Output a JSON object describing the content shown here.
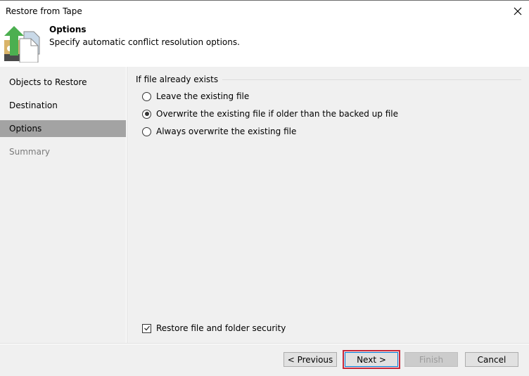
{
  "window": {
    "title": "Restore from Tape",
    "close_icon": "close-icon"
  },
  "header": {
    "icon": "restore-from-tape-icon",
    "heading": "Options",
    "subtitle": "Specify automatic conflict resolution options."
  },
  "sidebar": {
    "items": [
      {
        "label": "Objects to Restore",
        "state": "normal"
      },
      {
        "label": "Destination",
        "state": "normal"
      },
      {
        "label": "Options",
        "state": "active"
      },
      {
        "label": "Summary",
        "state": "disabled"
      }
    ]
  },
  "options": {
    "group_label": "If file already exists",
    "radios": [
      {
        "label": "Leave the existing file",
        "checked": false
      },
      {
        "label": "Overwrite the existing file if older than the backed up file",
        "checked": true
      },
      {
        "label": "Always overwrite the existing file",
        "checked": false
      }
    ],
    "security_checkbox": {
      "label": "Restore file and folder security",
      "checked": true
    }
  },
  "footer": {
    "previous_label": "< Previous",
    "next_label": "Next >",
    "finish_label": "Finish",
    "cancel_label": "Cancel"
  },
  "colors": {
    "active_nav": "#a3a3a3",
    "highlight_outline": "#c8283a",
    "arrow_green": "#4caf50"
  }
}
